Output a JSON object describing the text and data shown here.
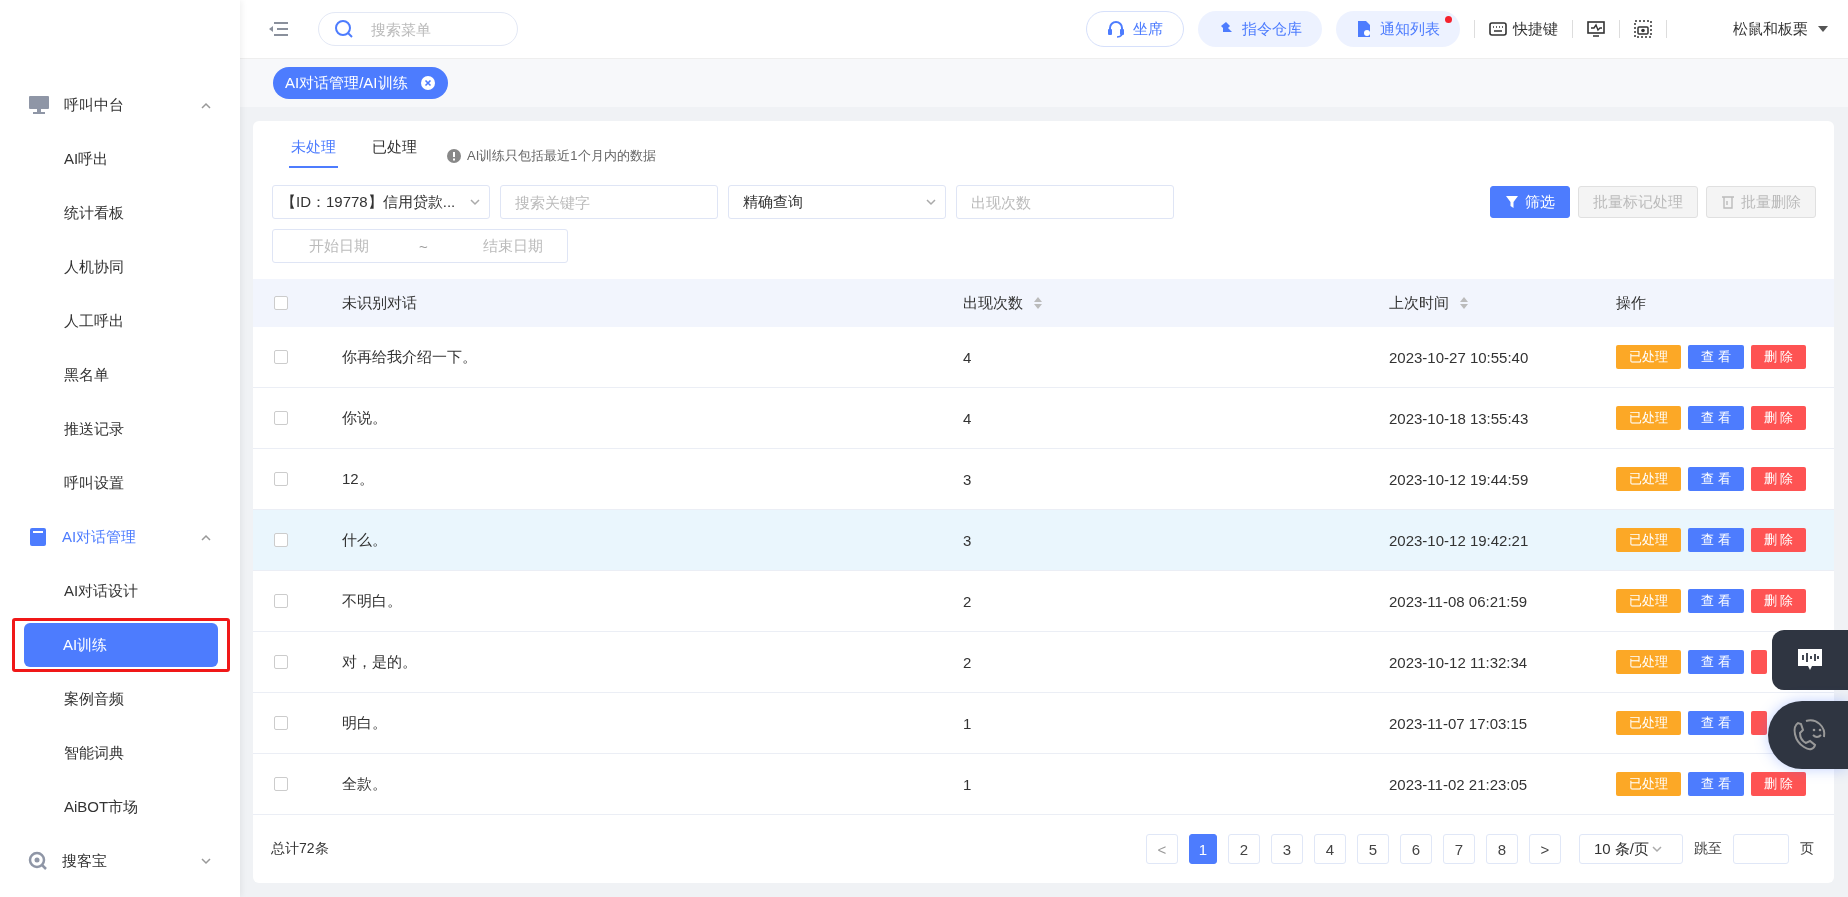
{
  "sidebar": {
    "groups": [
      {
        "label": "呼叫中台",
        "expanded": true,
        "active": false,
        "children": [
          {
            "label": "AI呼出",
            "selected": false,
            "marked": false
          },
          {
            "label": "统计看板",
            "selected": false,
            "marked": false
          },
          {
            "label": "人机协同",
            "selected": false,
            "marked": false
          },
          {
            "label": "人工呼出",
            "selected": false,
            "marked": false
          },
          {
            "label": "黑名单",
            "selected": false,
            "marked": false
          },
          {
            "label": "推送记录",
            "selected": false,
            "marked": false
          },
          {
            "label": "呼叫设置",
            "selected": false,
            "marked": false
          }
        ]
      },
      {
        "label": "AI对话管理",
        "expanded": true,
        "active": true,
        "children": [
          {
            "label": "AI对话设计",
            "selected": false,
            "marked": false
          },
          {
            "label": "AI训练",
            "selected": true,
            "marked": true
          },
          {
            "label": "案例音频",
            "selected": false,
            "marked": false
          },
          {
            "label": "智能词典",
            "selected": false,
            "marked": false
          },
          {
            "label": "AiBOT市场",
            "selected": false,
            "marked": false
          }
        ]
      },
      {
        "label": "搜客宝",
        "expanded": false,
        "active": false
      }
    ]
  },
  "topbar": {
    "search_placeholder": "搜索菜单",
    "buttons": [
      {
        "label": "坐席",
        "kind": "outline",
        "badge": false
      },
      {
        "label": "指令仓库",
        "kind": "soft",
        "badge": false
      },
      {
        "label": "通知列表",
        "kind": "soft",
        "badge": true
      }
    ],
    "shortcut": "快捷键",
    "user": "松鼠和板栗"
  },
  "tags": [
    {
      "label": "AI对话管理/AI训练",
      "selected": true
    }
  ],
  "tabs": [
    {
      "label": "未处理",
      "selected": true
    },
    {
      "label": "已处理",
      "selected": false
    }
  ],
  "notice": "AI训练只包括最近1个月内的数据",
  "filters": [
    {
      "kind": "select",
      "value": "【ID：19778】信用贷款..."
    },
    {
      "kind": "input",
      "placeholder": "搜索关键字"
    },
    {
      "kind": "select",
      "value": "精确查询"
    },
    {
      "kind": "input",
      "placeholder": "出现次数"
    },
    {
      "kind": "daterange",
      "start_placeholder": "开始日期",
      "separator": "~",
      "end_placeholder": "结束日期"
    }
  ],
  "actions": [
    {
      "label": "筛选",
      "kind": "filter",
      "disabled": false
    },
    {
      "label": "批量标记处理",
      "kind": "plain",
      "disabled": true
    },
    {
      "label": "批量删除",
      "kind": "delete",
      "disabled": true
    }
  ],
  "table": {
    "select_all_checked": false,
    "columns": [
      {
        "label": "未识别对话",
        "sortable": false
      },
      {
        "label": "出现次数",
        "sortable": true
      },
      {
        "label": "上次时间",
        "sortable": true
      },
      {
        "label": "操作",
        "sortable": false
      }
    ],
    "rows": [
      {
        "checked": false,
        "hovered": false,
        "text": "你再给我介绍一下。",
        "count": "4",
        "time": "2023-10-27 10:55:40",
        "actions": [
          {
            "kind": "mark",
            "label": "已处理"
          },
          {
            "kind": "view",
            "label": "查 看"
          },
          {
            "kind": "delete",
            "label": "删 除"
          }
        ]
      },
      {
        "checked": false,
        "hovered": false,
        "text": "你说。",
        "count": "4",
        "time": "2023-10-18 13:55:43",
        "actions": [
          {
            "kind": "mark",
            "label": "已处理"
          },
          {
            "kind": "view",
            "label": "查 看"
          },
          {
            "kind": "delete",
            "label": "删 除"
          }
        ]
      },
      {
        "checked": false,
        "hovered": false,
        "text": "12。",
        "count": "3",
        "time": "2023-10-12 19:44:59",
        "actions": [
          {
            "kind": "mark",
            "label": "已处理"
          },
          {
            "kind": "view",
            "label": "查 看"
          },
          {
            "kind": "delete",
            "label": "删 除"
          }
        ]
      },
      {
        "checked": false,
        "hovered": true,
        "text": "什么。",
        "count": "3",
        "time": "2023-10-12 19:42:21",
        "actions": [
          {
            "kind": "mark",
            "label": "已处理"
          },
          {
            "kind": "view",
            "label": "查 看"
          },
          {
            "kind": "delete",
            "label": "删 除"
          }
        ]
      },
      {
        "checked": false,
        "hovered": false,
        "text": "不明白。",
        "count": "2",
        "time": "2023-11-08 06:21:59",
        "actions": [
          {
            "kind": "mark",
            "label": "已处理"
          },
          {
            "kind": "view",
            "label": "查 看"
          },
          {
            "kind": "delete",
            "label": "删 除"
          }
        ]
      },
      {
        "checked": false,
        "hovered": false,
        "text": "对，是的。",
        "count": "2",
        "time": "2023-10-12 11:32:34",
        "actions": [
          {
            "kind": "mark",
            "label": "已处理"
          },
          {
            "kind": "view",
            "label": "查 看"
          },
          {
            "kind": "delete"
          }
        ]
      },
      {
        "checked": false,
        "hovered": false,
        "text": "明白。",
        "count": "1",
        "time": "2023-11-07 17:03:15",
        "actions": [
          {
            "kind": "mark",
            "label": "已处理"
          },
          {
            "kind": "view",
            "label": "查 看"
          },
          {
            "kind": "delete"
          }
        ]
      },
      {
        "checked": false,
        "hovered": false,
        "text": "全款。",
        "count": "1",
        "time": "2023-11-02 21:23:05",
        "actions": [
          {
            "kind": "mark",
            "label": "已处理"
          },
          {
            "kind": "view",
            "label": "查 看"
          },
          {
            "kind": "delete",
            "label": "删 除"
          }
        ]
      }
    ]
  },
  "pagination": {
    "total": "总计72条",
    "prev": "<",
    "next": ">",
    "pages": [
      {
        "label": "1",
        "selected": true
      },
      {
        "label": "2",
        "selected": false
      },
      {
        "label": "3",
        "selected": false
      },
      {
        "label": "4",
        "selected": false
      },
      {
        "label": "5",
        "selected": false
      },
      {
        "label": "6",
        "selected": false
      },
      {
        "label": "7",
        "selected": false
      },
      {
        "label": "8",
        "selected": false
      }
    ],
    "page_size": "10 条/页",
    "jump_label": "跳至",
    "page_suffix": "页"
  }
}
